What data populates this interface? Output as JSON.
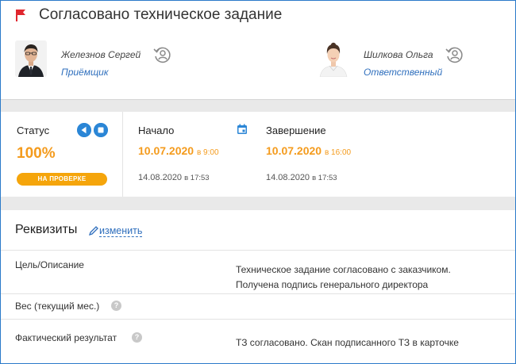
{
  "header": {
    "title": "Согласовано техническое задание"
  },
  "participants": [
    {
      "name": "Железнов Сергей",
      "role": "Приёмщик"
    },
    {
      "name": "Шилкова Ольга",
      "role": "Ответственный"
    }
  ],
  "status": {
    "label": "Статус",
    "percent": "100%",
    "badge": "НА ПРОВЕРКЕ"
  },
  "start": {
    "label": "Начало",
    "planned_date": "10.07.2020",
    "planned_time": "в 9:00",
    "actual_date": "14.08.2020",
    "actual_time": "в 17:53"
  },
  "end": {
    "label": "Завершение",
    "planned_date": "10.07.2020",
    "planned_time": "в 16:00",
    "actual_date": "14.08.2020",
    "actual_time": "в 17:53"
  },
  "requisites": {
    "title": "Реквизиты",
    "edit_label": "изменить",
    "rows": [
      {
        "label": "Цель/Описание",
        "value_line1": "Техническое задание согласовано с заказчиком.",
        "value_line2": "Получена подпись генерального директора"
      },
      {
        "label": "Вес (текущий мес.)",
        "value_line1": "",
        "value_line2": ""
      },
      {
        "label": "Фактический результат",
        "value_line1": "ТЗ согласовано. Скан подписанного ТЗ в карточке",
        "value_line2": ""
      }
    ]
  },
  "colors": {
    "accent_orange": "#f49b1d",
    "badge_bg": "#f5a50b",
    "link_blue": "#2f6fbd",
    "flag_red": "#e0262e",
    "control_blue": "#2b86d6"
  },
  "icons": {
    "flag": "flag-icon",
    "reassign": "person-reassign-icon",
    "rewind": "rewind-icon",
    "stop": "stop-icon",
    "calendar": "calendar-icon",
    "pencil": "pencil-icon",
    "help": "help-icon"
  }
}
